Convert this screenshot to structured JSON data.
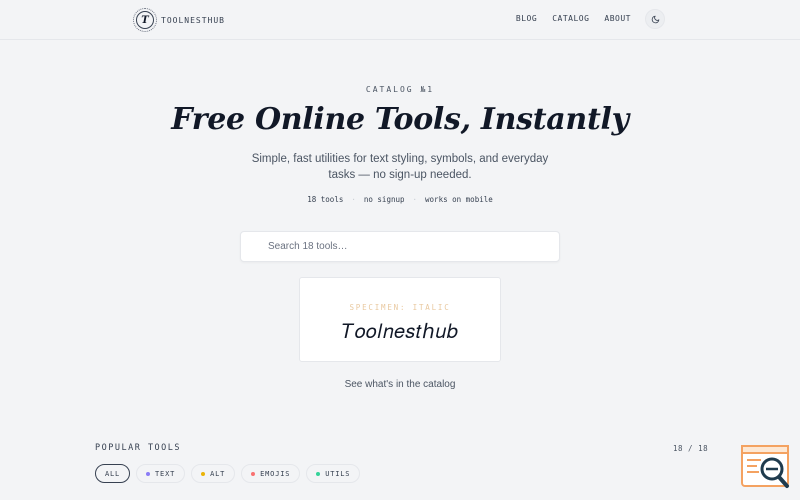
{
  "header": {
    "brand": "TOOLNESTHUB",
    "logo_letter": "T",
    "nav": [
      {
        "label": "BLOG"
      },
      {
        "label": "CATALOG"
      },
      {
        "label": "ABOUT"
      }
    ],
    "theme_icon": "moon-icon"
  },
  "hero": {
    "eyebrow": "CATALOG №1",
    "title": "Free Online Tools, Instantly",
    "subtitle": "Simple, fast utilities for text styling, symbols, and everyday tasks — no sign-up needed.",
    "stats": [
      "18 tools",
      "no signup",
      "works on mobile"
    ],
    "stats_separator": "·"
  },
  "search": {
    "placeholder": "Search 18 tools…",
    "value": ""
  },
  "specimen": {
    "label": "SPECIMEN: ITALIC",
    "text": "𝑇𝑜𝑜𝑙𝑛𝑒𝑠𝑡ℎ𝑢𝑏"
  },
  "catalog_link": "See what's in the catalog",
  "popular": {
    "title": "POPULAR TOOLS",
    "count": "18 / 18",
    "filters": [
      {
        "label": "ALL",
        "active": true,
        "color": ""
      },
      {
        "label": "TEXT",
        "active": false,
        "color": "#8b7cf6"
      },
      {
        "label": "ALT",
        "active": false,
        "color": "#eab308"
      },
      {
        "label": "EMOJIS",
        "active": false,
        "color": "#f87171"
      },
      {
        "label": "UTILS",
        "active": false,
        "color": "#34d399"
      }
    ]
  },
  "colors": {
    "background": "#f3f4f6",
    "text": "#1f2937",
    "specimen_label": "#e9c9a0",
    "widget_accent": "#f4a261"
  }
}
